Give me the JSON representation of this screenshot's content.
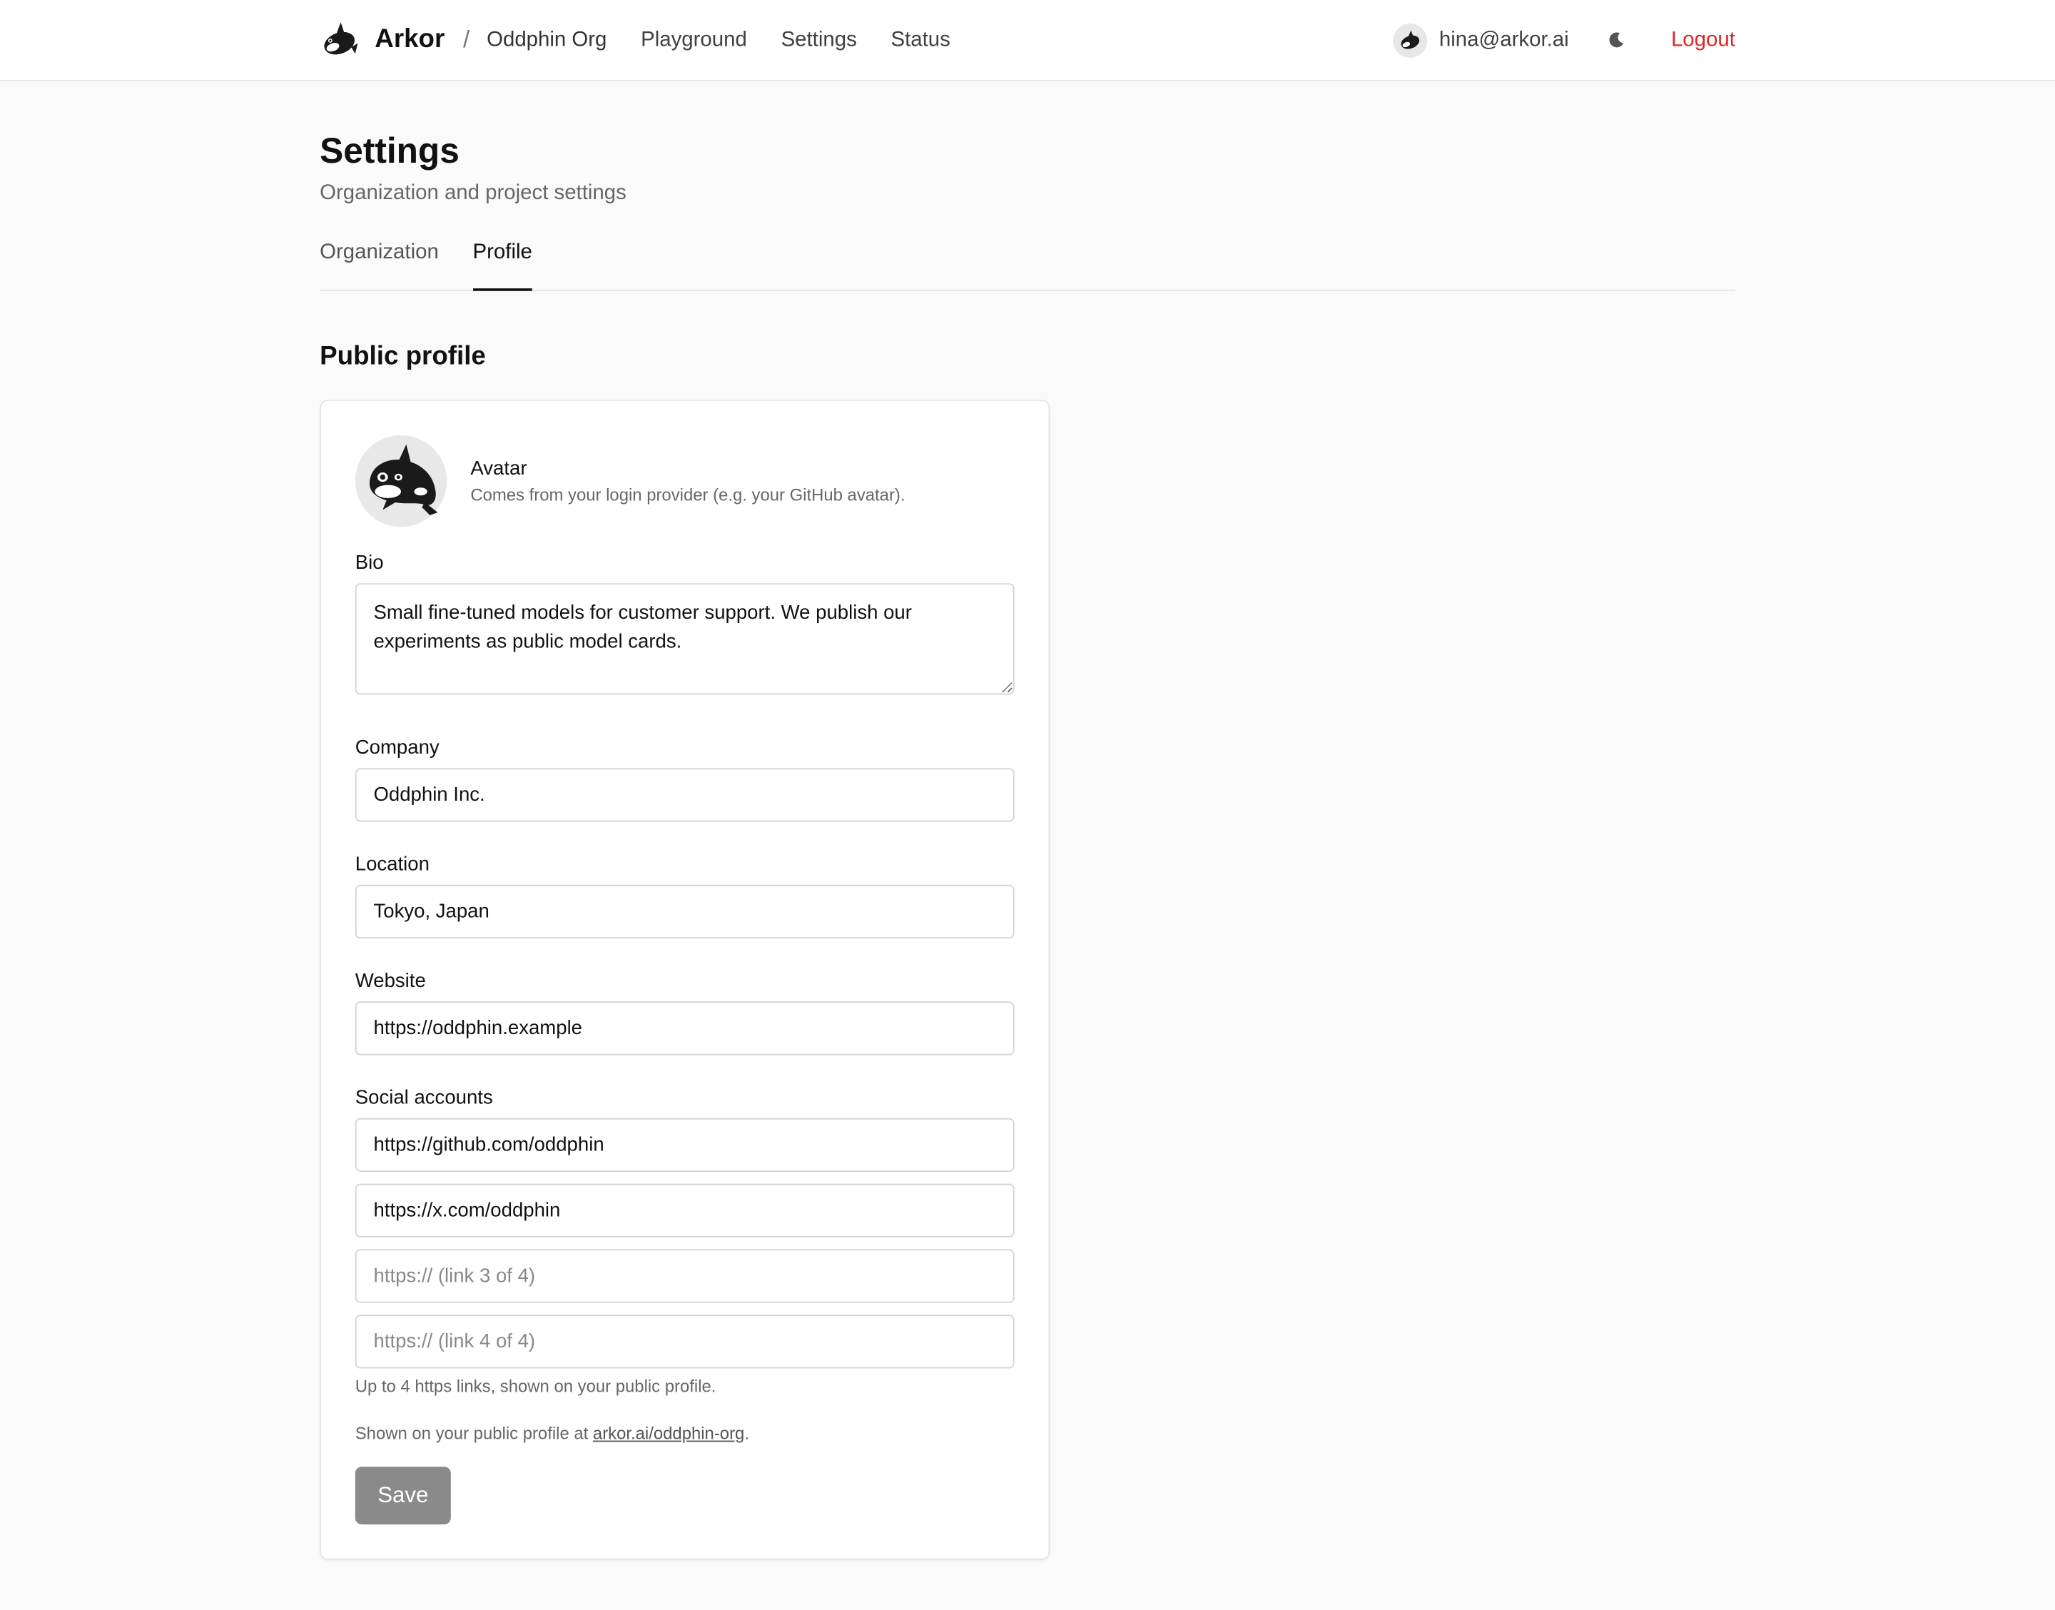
{
  "header": {
    "brand": "Arkor",
    "separator": "/",
    "org": "Oddphin Org",
    "nav": [
      "Playground",
      "Settings",
      "Status"
    ],
    "user_email": "hina@arkor.ai",
    "logout": "Logout"
  },
  "page": {
    "title": "Settings",
    "subtitle": "Organization and project settings",
    "tabs": [
      {
        "label": "Organization",
        "active": false
      },
      {
        "label": "Profile",
        "active": true
      }
    ]
  },
  "profile": {
    "section_title": "Public profile",
    "avatar_label": "Avatar",
    "avatar_help": "Comes from your login provider (e.g. your GitHub avatar).",
    "bio_label": "Bio",
    "bio_value": "Small fine-tuned models for customer support. We publish our experiments as public model cards.",
    "company_label": "Company",
    "company_value": "Oddphin Inc.",
    "location_label": "Location",
    "location_value": "Tokyo, Japan",
    "website_label": "Website",
    "website_value": "https://oddphin.example",
    "social_label": "Social accounts",
    "social": [
      {
        "value": "https://github.com/oddphin",
        "placeholder": ""
      },
      {
        "value": "https://x.com/oddphin",
        "placeholder": ""
      },
      {
        "value": "",
        "placeholder": "https:// (link 3 of 4)"
      },
      {
        "value": "",
        "placeholder": "https:// (link 4 of 4)"
      }
    ],
    "social_hint": "Up to 4 https links, shown on your public profile.",
    "public_note_prefix": "Shown on your public profile at ",
    "public_link": "arkor.ai/oddphin-org",
    "public_note_suffix": ".",
    "save_label": "Save"
  },
  "colors": {
    "logout": "#dc2626",
    "save_button": "#8a8a8a",
    "background": "#fafafa"
  },
  "icons": {
    "logo": "orca-icon",
    "user_avatar": "orca-icon",
    "theme_toggle": "moon-icon"
  }
}
